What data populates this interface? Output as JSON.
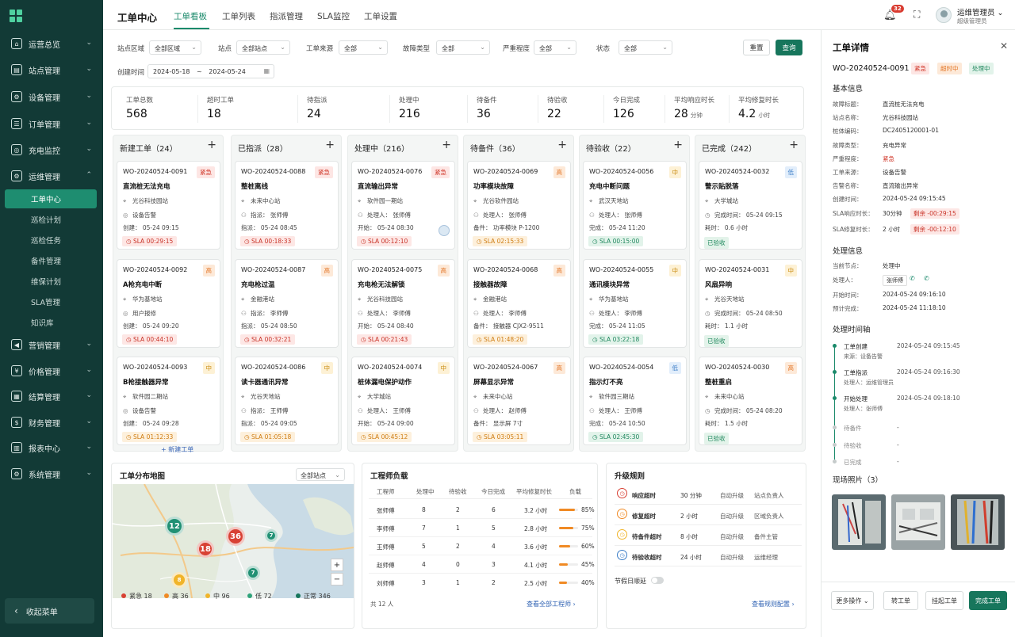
{
  "sidebar": {
    "items": [
      {
        "label": "运营总览",
        "icon": "home-icon",
        "glyph": "⌂"
      },
      {
        "label": "站点管理",
        "icon": "building-icon",
        "glyph": "▤"
      },
      {
        "label": "设备管理",
        "icon": "device-icon",
        "glyph": "⚙"
      },
      {
        "label": "订单管理",
        "icon": "order-icon",
        "glyph": "☰"
      },
      {
        "label": "充电监控",
        "icon": "monitor-icon",
        "glyph": "◎"
      },
      {
        "label": "运维管理",
        "icon": "maintenance-icon",
        "glyph": "⚙"
      },
      {
        "label": "营销管理",
        "icon": "megaphone-icon",
        "glyph": "◀"
      },
      {
        "label": "价格管理",
        "icon": "price-icon",
        "glyph": "¥"
      },
      {
        "label": "结算管理",
        "icon": "settlement-icon",
        "glyph": "▦"
      },
      {
        "label": "财务管理",
        "icon": "finance-icon",
        "glyph": "$"
      },
      {
        "label": "报表中心",
        "icon": "report-icon",
        "glyph": "▥"
      },
      {
        "label": "系统管理",
        "icon": "settings-icon",
        "glyph": "⚙"
      }
    ],
    "subitems": [
      "工单中心",
      "巡检计划",
      "巡检任务",
      "备件管理",
      "维保计划",
      "SLA管理",
      "知识库"
    ],
    "collapse_label": "收起菜单"
  },
  "topbar": {
    "title": "工单中心",
    "tabs": [
      "工单看板",
      "工单列表",
      "指派管理",
      "SLA监控",
      "工单设置"
    ],
    "notifications": "32",
    "user_name": "运维管理员",
    "user_role": "超级管理员"
  },
  "filters": {
    "site_area_label": "站点区域",
    "site_area_value": "全部区域",
    "site_label": "站点",
    "site_value": "全部站点",
    "source_label": "工单来源",
    "source_value": "全部",
    "fault_label": "故障类型",
    "fault_value": "全部",
    "severity_label": "严重程度",
    "severity_value": "全部",
    "status_label": "状态",
    "status_value": "全部",
    "created_label": "创建时间",
    "date_from": "2024-05-18",
    "date_sep": "~",
    "date_to": "2024-05-24",
    "reset": "重置",
    "query": "查询"
  },
  "stats": [
    {
      "label": "工单总数",
      "value": "568",
      "unit": ""
    },
    {
      "label": "超时工单",
      "value": "18",
      "unit": ""
    },
    {
      "label": "待指派",
      "value": "24",
      "unit": ""
    },
    {
      "label": "处理中",
      "value": "216",
      "unit": ""
    },
    {
      "label": "待备件",
      "value": "36",
      "unit": ""
    },
    {
      "label": "待验收",
      "value": "22",
      "unit": ""
    },
    {
      "label": "今日完成",
      "value": "126",
      "unit": ""
    },
    {
      "label": "平均响应时长",
      "value": "28",
      "unit": "分钟"
    },
    {
      "label": "平均修复时长",
      "value": "4.2",
      "unit": "小时"
    }
  ],
  "columns": [
    {
      "title": "新建工单（24）",
      "add_link": "+ 新建工单",
      "cards": [
        {
          "no": "WO-20240524-0091",
          "badge": "紧急",
          "title": "直流桩无法充电",
          "l1": "光谷科技园站",
          "l2": "设备告警",
          "l3": "创建：   05-24 09:15",
          "sla": "SLA 00:29:15",
          "sc": "red"
        },
        {
          "no": "WO-20240524-0092",
          "badge": "高",
          "title": "A枪充电中断",
          "l1": "华为基地站",
          "l2": "用户报修",
          "l3": "创建：   05-24 09:20",
          "sla": "SLA 00:44:10",
          "sc": "red"
        },
        {
          "no": "WO-20240524-0093",
          "badge": "中",
          "title": "B枪接触器异常",
          "l1": "软件园二期站",
          "l2": "设备告警",
          "l3": "创建：   05-24 09:28",
          "sla": "SLA 01:12:33",
          "sc": "orange"
        }
      ]
    },
    {
      "title": "已指派（28）",
      "cards": [
        {
          "no": "WO-20240524-0088",
          "badge": "紧急",
          "title": "整桩离线",
          "l1": "未来中心站",
          "l2": "指派：  张师傅",
          "l3": "指派：   05-24 08:45",
          "sla": "SLA 00:18:33",
          "sc": "red"
        },
        {
          "no": "WO-20240524-0087",
          "badge": "高",
          "title": "充电枪过温",
          "l1": "金融港站",
          "l2": "指派：  李师傅",
          "l3": "指派：   05-24 08:50",
          "sla": "SLA 00:32:21",
          "sc": "red"
        },
        {
          "no": "WO-20240524-0086",
          "badge": "中",
          "title": "读卡器通讯异常",
          "l1": "光谷天地站",
          "l2": "指派：  王师傅",
          "l3": "指派：   05-24 09:05",
          "sla": "SLA 01:05:18",
          "sc": "orange"
        }
      ]
    },
    {
      "title": "处理中（216）",
      "cards": [
        {
          "no": "WO-20240524-0076",
          "badge": "紧急",
          "title": "直流输出异常",
          "l1": "软件园一期站",
          "l2": "处理人：  张师傅",
          "l3": "开始：   05-24 08:30",
          "sla": "SLA 00:12:10",
          "sc": "red"
        },
        {
          "no": "WO-20240524-0075",
          "badge": "高",
          "title": "充电枪无法解锁",
          "l1": "光谷科技园站",
          "l2": "处理人：  李师傅",
          "l3": "开始：   05-24 08:40",
          "sla": "SLA 00:21:43",
          "sc": "red"
        },
        {
          "no": "WO-20240524-0074",
          "badge": "中",
          "title": "桩体漏电保护动作",
          "l1": "大学城站",
          "l2": "处理人：  王师傅",
          "l3": "开始：   05-24 09:00",
          "sla": "SLA 00:45:12",
          "sc": "orange"
        }
      ]
    },
    {
      "title": "待备件（36）",
      "cards": [
        {
          "no": "WO-20240524-0069",
          "badge": "高",
          "title": "功率模块故障",
          "l1": "光谷软件园站",
          "l2": "处理人：  张师傅",
          "l3": "备件：   功率模块 P-1200",
          "sla": "SLA 02:15:33",
          "sc": "orange"
        },
        {
          "no": "WO-20240524-0068",
          "badge": "高",
          "title": "接触器故障",
          "l1": "金融港站",
          "l2": "处理人：  李师傅",
          "l3": "备件：   接触器 CJX2-9511",
          "sla": "SLA 01:48:20",
          "sc": "orange"
        },
        {
          "no": "WO-20240524-0067",
          "badge": "高",
          "title": "屏幕显示异常",
          "l1": "未来中心站",
          "l2": "处理人：  赵师傅",
          "l3": "备件：   显示屏 7寸",
          "sla": "SLA 03:05:11",
          "sc": "orange"
        }
      ]
    },
    {
      "title": "待验收（22）",
      "cards": [
        {
          "no": "WO-20240524-0056",
          "badge": "中",
          "title": "充电中断问题",
          "l1": "武汉天地站",
          "l2": "处理人：  张师傅",
          "l3": "完成：   05-24 11:20",
          "sla": "SLA 00:15:00",
          "sc": "green"
        },
        {
          "no": "WO-20240524-0055",
          "badge": "中",
          "title": "通讯模块异常",
          "l1": "华为基地站",
          "l2": "处理人：  李师傅",
          "l3": "完成：   05-24 11:05",
          "sla": "SLA 03:22:18",
          "sc": "green"
        },
        {
          "no": "WO-20240524-0054",
          "badge": "低",
          "title": "指示灯不亮",
          "l1": "软件园三期站",
          "l2": "处理人：  王师傅",
          "l3": "完成：   05-24 10:50",
          "sla": "SLA 02:45:30",
          "sc": "green"
        }
      ]
    },
    {
      "title": "已完成（242）",
      "cards": [
        {
          "no": "WO-20240524-0032",
          "badge": "低",
          "title": "警示贴脱落",
          "l1": "大学城站",
          "l2": "完成时间：  05-24 09:15",
          "l3": "耗时：   0.6 小时",
          "done": "已验收"
        },
        {
          "no": "WO-20240524-0031",
          "badge": "中",
          "title": "风扇异响",
          "l1": "光谷天地站",
          "l2": "完成时间：  05-24 08:50",
          "l3": "耗时：   1.1 小时",
          "done": "已验收"
        },
        {
          "no": "WO-20240524-0030",
          "badge": "高",
          "title": "整桩重启",
          "l1": "未来中心站",
          "l2": "完成时间：  05-24 08:20",
          "l3": "耗时：   1.5 小时",
          "done": "已验收"
        }
      ]
    }
  ],
  "map_panel": {
    "title": "工单分布地图",
    "site_select": "全部站点",
    "clusters": [
      {
        "n": "12",
        "color": "#219174"
      },
      {
        "n": "36",
        "color": "#d84134"
      },
      {
        "n": "18",
        "color": "#d84134"
      },
      {
        "n": "7",
        "color": "#219174"
      },
      {
        "n": "7",
        "color": "#219174"
      },
      {
        "n": "8",
        "color": "#f0b429"
      }
    ],
    "legend": [
      {
        "label": "紧急",
        "count": "18",
        "color": "#d84134"
      },
      {
        "label": "高",
        "count": "36",
        "color": "#f08a24"
      },
      {
        "label": "中",
        "count": "96",
        "color": "#f0b429"
      },
      {
        "label": "低",
        "count": "72",
        "color": "#2fa37a"
      },
      {
        "label": "正常",
        "count": "346",
        "color": "#17765c"
      }
    ]
  },
  "engineers": {
    "title": "工程师负载",
    "headers": [
      "工程师",
      "处理中",
      "待验收",
      "今日完成",
      "平均修复时长",
      "负载"
    ],
    "rows": [
      {
        "name": "张师傅",
        "doing": "8",
        "check": "2",
        "done": "6",
        "avg": "3.2 小时",
        "load": 0.85,
        "load_text": "85%"
      },
      {
        "name": "李师傅",
        "doing": "7",
        "check": "1",
        "done": "5",
        "avg": "2.8 小时",
        "load": 0.75,
        "load_text": "75%"
      },
      {
        "name": "王师傅",
        "doing": "5",
        "check": "2",
        "done": "4",
        "avg": "3.6 小时",
        "load": 0.6,
        "load_text": "60%"
      },
      {
        "name": "赵师傅",
        "doing": "4",
        "check": "0",
        "done": "3",
        "avg": "4.1 小时",
        "load": 0.45,
        "load_text": "45%"
      },
      {
        "name": "刘师傅",
        "doing": "3",
        "check": "1",
        "done": "2",
        "avg": "2.5 小时",
        "load": 0.4,
        "load_text": "40%"
      }
    ],
    "total": "共 12 人",
    "view_all": "查看全部工程师 ›"
  },
  "escalation": {
    "title": "升级规则",
    "rows": [
      {
        "name": "响应超时",
        "time": "30 分钟",
        "action": "自动升级",
        "target": "站点负责人",
        "color": "#d84134"
      },
      {
        "name": "修复超时",
        "time": "2 小时",
        "action": "自动升级",
        "target": "区域负责人",
        "color": "#f08a24"
      },
      {
        "name": "待备件超时",
        "time": "8 小时",
        "action": "自动升级",
        "target": "备件主管",
        "color": "#f0b429"
      },
      {
        "name": "待验收超时",
        "time": "24 小时",
        "action": "自动升级",
        "target": "运维经理",
        "color": "#3b7dc7"
      }
    ],
    "holiday": "节假日顺延",
    "view_config": "查看规则配置 ›"
  },
  "detail": {
    "title": "工单详情",
    "order_no": "WO-20240524-0091",
    "tags": [
      "紧急",
      "超时中",
      "处理中"
    ],
    "basic_title": "基本信息",
    "basic": [
      {
        "k": "故障标题：",
        "v": "直流桩无法充电"
      },
      {
        "k": "站点名称：",
        "v": "光谷科技园站"
      },
      {
        "k": "桩体编码：",
        "v": "DC2405120001-01"
      },
      {
        "k": "故障类型：",
        "v": "充电异常"
      },
      {
        "k": "严重程度：",
        "v": "紧急"
      },
      {
        "k": "工单来源：",
        "v": "设备告警"
      },
      {
        "k": "告警名称：",
        "v": "直流输出异常"
      },
      {
        "k": "创建时间：",
        "v": "2024-05-24 09:15:45"
      }
    ],
    "sla_resp_label": "SLA响应时长：",
    "sla_resp_val": "30分钟",
    "sla_resp_remain": "剩余 -00:29:15",
    "sla_fix_label": "SLA修复时长：",
    "sla_fix_val": "2 小时",
    "sla_fix_remain": "剩余 -00:12:10",
    "process_title": "处理信息",
    "node_label": "当前节点：",
    "node_val": "处理中",
    "handler_label": "处理人：",
    "handler_val": "张师傅",
    "start_label": "开始时间：",
    "start_val": "2024-05-24 09:16:10",
    "eta_label": "预计完成：",
    "eta_val": "2024-05-24 11:18:10",
    "timeline_title": "处理时间轴",
    "timeline": [
      {
        "t": "工单创建",
        "time": "2024-05-24 09:15:45",
        "sub": "来源：设备告警",
        "done": true
      },
      {
        "t": "工单指派",
        "time": "2024-05-24 09:16:30",
        "sub": "处理人：运维管理员",
        "done": true
      },
      {
        "t": "开始处理",
        "time": "2024-05-24 09:18:10",
        "sub": "处理人：张师傅",
        "done": true
      },
      {
        "t": "待备件",
        "time": "-",
        "sub": "",
        "done": false
      },
      {
        "t": "待验收",
        "time": "-",
        "sub": "",
        "done": false
      },
      {
        "t": "已完成",
        "time": "-",
        "sub": "",
        "done": false
      }
    ],
    "photos_title": "现场照片（3）",
    "buttons": {
      "more": "更多操作 ⌄",
      "transfer": "转工单",
      "hang": "挂起工单",
      "complete": "完成工单"
    }
  }
}
